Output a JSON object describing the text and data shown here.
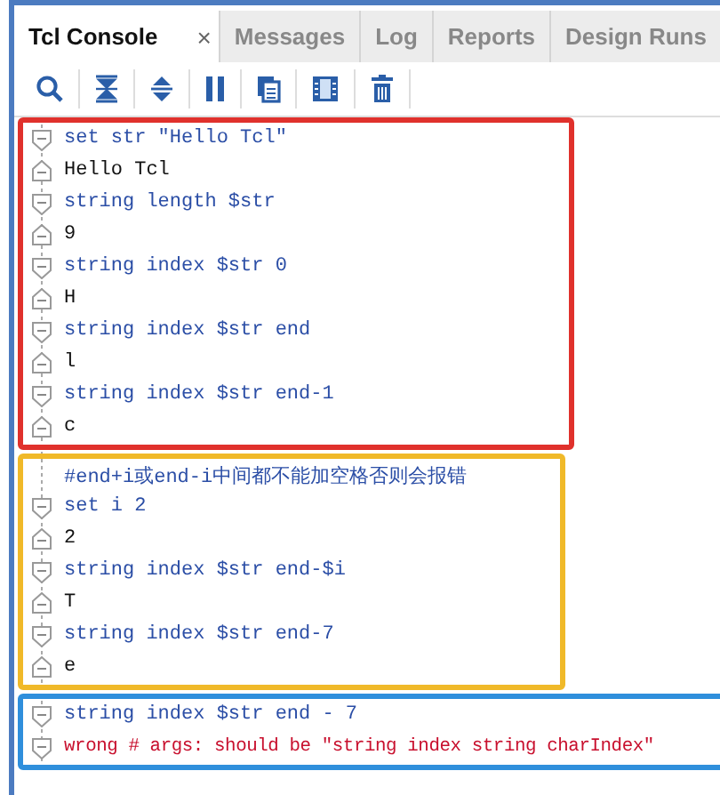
{
  "tabs": [
    {
      "label": "Tcl Console",
      "selected": true,
      "close": "×"
    },
    {
      "label": "Messages",
      "selected": false
    },
    {
      "label": "Log",
      "selected": false
    },
    {
      "label": "Reports",
      "selected": false
    },
    {
      "label": "Design Runs",
      "selected": false
    }
  ],
  "toolbar": [
    {
      "kind": "search"
    },
    {
      "kind": "collapse"
    },
    {
      "kind": "expand"
    },
    {
      "kind": "pause"
    },
    {
      "kind": "copy"
    },
    {
      "kind": "columns"
    },
    {
      "kind": "delete"
    }
  ],
  "groups": [
    {
      "color": "#e0312c",
      "lines": [
        {
          "kind": "command",
          "text": "set str \"Hello Tcl\""
        },
        {
          "kind": "output",
          "text": "Hello Tcl"
        },
        {
          "kind": "command",
          "text": "string length $str"
        },
        {
          "kind": "output",
          "text": "9"
        },
        {
          "kind": "command",
          "text": "string index $str 0"
        },
        {
          "kind": "output",
          "text": "H"
        },
        {
          "kind": "command",
          "text": "string index $str end"
        },
        {
          "kind": "output",
          "text": "l"
        },
        {
          "kind": "command",
          "text": "string index $str end-1"
        },
        {
          "kind": "output",
          "text": "c"
        }
      ]
    },
    {
      "color": "#f0b929",
      "lines": [
        {
          "kind": "comment",
          "text": "#end+i或end-i中间都不能加空格否则会报错"
        },
        {
          "kind": "command",
          "text": "set i 2"
        },
        {
          "kind": "output",
          "text": "2"
        },
        {
          "kind": "command",
          "text": "string index $str end-$i"
        },
        {
          "kind": "output",
          "text": "T"
        },
        {
          "kind": "command",
          "text": "string index $str end-7"
        },
        {
          "kind": "output",
          "text": "e"
        }
      ]
    },
    {
      "color": "#2f8fdc",
      "lines": [
        {
          "kind": "command",
          "text": "string index $str end - 7"
        },
        {
          "kind": "error",
          "text": "wrong # args: should be \"string index string charIndex\""
        }
      ]
    }
  ]
}
